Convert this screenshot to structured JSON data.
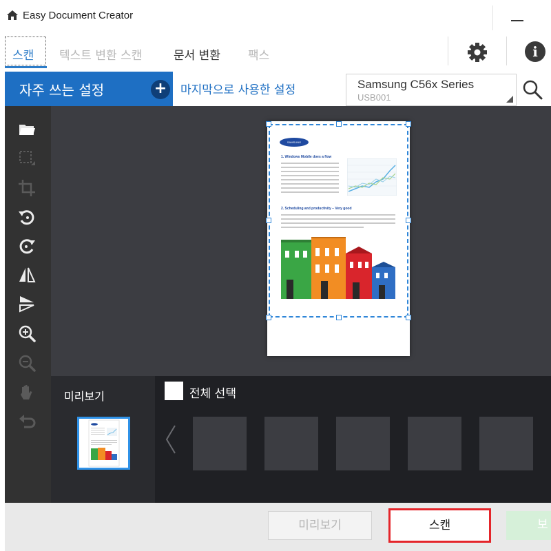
{
  "window": {
    "title": "Easy Document Creator"
  },
  "tabs": [
    {
      "label": "스캔",
      "state": "active"
    },
    {
      "label": "텍스트 변환 스캔",
      "state": "disabled"
    },
    {
      "label": "문서 변환",
      "state": "normal"
    },
    {
      "label": "팩스",
      "state": "disabled"
    }
  ],
  "settings": {
    "favorites_label": "자주 쓰는 설정",
    "add_symbol": "+",
    "last_used_label": "마지막으로 사용한 설정"
  },
  "device": {
    "name": "Samsung C56x Series",
    "port": "USB001"
  },
  "toolbar": {
    "icons": [
      "folder-open-icon",
      "select-area-icon",
      "crop-icon",
      "rotate-left-icon",
      "rotate-right-icon",
      "flip-horizontal-icon",
      "flip-vertical-icon",
      "zoom-in-icon",
      "zoom-out-icon",
      "hand-pan-icon",
      "undo-icon"
    ]
  },
  "document": {
    "logo_text": "SAMSUNG",
    "heading1": "1. Windows Mobile does a flow",
    "heading2": "2. Scheduling and productivity – Very good"
  },
  "preview_panel": {
    "label": "미리보기"
  },
  "gallery": {
    "select_all_label": "전체 선택",
    "prev_arrow": "〈"
  },
  "buttons": {
    "preview": "미리보기",
    "scan": "스캔",
    "save": "보"
  },
  "info_symbol": "i",
  "colors": {
    "accent": "#1e6fc3",
    "highlight": "#e4252a",
    "toolbar_bg": "#323232",
    "preview_bg": "#3c3d42"
  }
}
